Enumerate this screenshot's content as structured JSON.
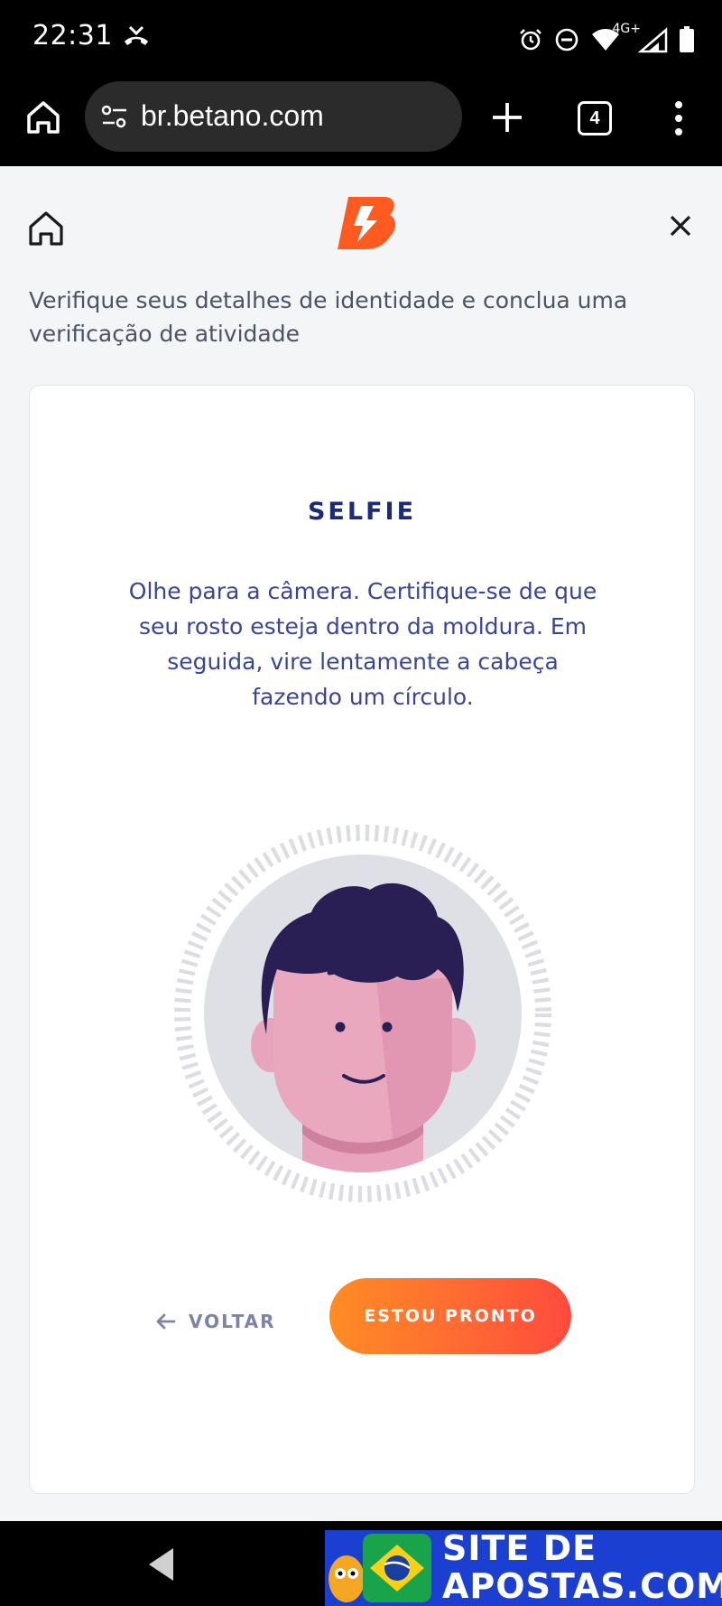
{
  "status_bar": {
    "time": "22:31",
    "network": "4G+",
    "icons": [
      "missed-call-icon",
      "alarm-icon",
      "do-not-disturb-icon",
      "wifi-icon",
      "signal-icon",
      "battery-icon"
    ]
  },
  "browser": {
    "url": "br.betano.com",
    "tab_count": "4",
    "icons": [
      "home-icon",
      "site-settings-icon",
      "plus-icon",
      "more-vert-icon"
    ]
  },
  "page": {
    "brand": "B",
    "intro": "Verifique seus detalhes de identidade e conclua uma verificação de atividade",
    "card": {
      "title": "SELFIE",
      "description": "Olhe para a câmera. Certifique-se de que seu rosto esteja dentro da moldura. Em seguida, vire lentamente a cabeça fazendo um círculo.",
      "back_label": "VOLTAR",
      "ready_label": "ESTOU PRONTO"
    }
  },
  "watermark": {
    "line1": "SITE DE",
    "line2": "APOSTAS.COM"
  },
  "colors": {
    "brand_orange": "#ff5a1f",
    "title_navy": "#1c2a7a",
    "desc_blue": "#3a4596",
    "button_gradient_start": "#ff8c24",
    "button_gradient_end": "#ff4a3d",
    "page_bg": "#f4f5f7",
    "watermark_blue": "#1a3fd1"
  }
}
